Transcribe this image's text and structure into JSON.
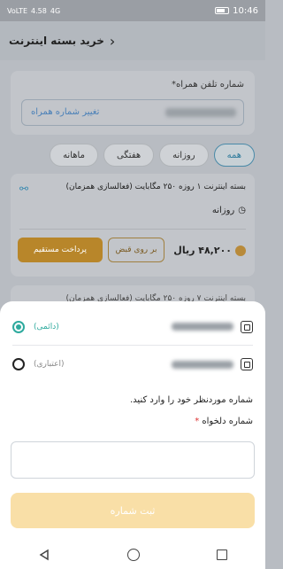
{
  "status": {
    "time": "10:46",
    "left_labels": [
      "VoLTE",
      "4.58",
      "4G"
    ],
    "battery": "battery-icon"
  },
  "header": {
    "title": "خرید بسته اینترنت",
    "back": "‹"
  },
  "phone": {
    "label": "شماره تلفن همراه*",
    "change": "تغییر شماره همراه"
  },
  "tabs": [
    "همه",
    "روزانه",
    "هفتگی",
    "ماهانه"
  ],
  "package": {
    "title": "بسته اینترنت ۱ روزه ۲۵۰ مگابایت (فعالسازی همزمان)",
    "period": "روزانه",
    "price": "۴۸,۲۰۰ ریال",
    "bill_button": "بر روی قبض",
    "direct_button": "پرداخت مستقیم"
  },
  "package2": {
    "title": "بسته اینترنت ۷ روزه ۲۵۰ مگابایت (فعالسازی همزمان)"
  },
  "sheet": {
    "option1_label": "(دائمی)",
    "option2_label": "(اعتباری)",
    "instruction": "شماره موردنظر خود را وارد کنید.",
    "desired_label": "شماره دلخواه",
    "desired_star": "*",
    "submit": "ثبت شماره"
  },
  "colors": {
    "accent": "#2eaa9e",
    "gold": "#b8862a",
    "disabled": "#f9dfa7"
  }
}
